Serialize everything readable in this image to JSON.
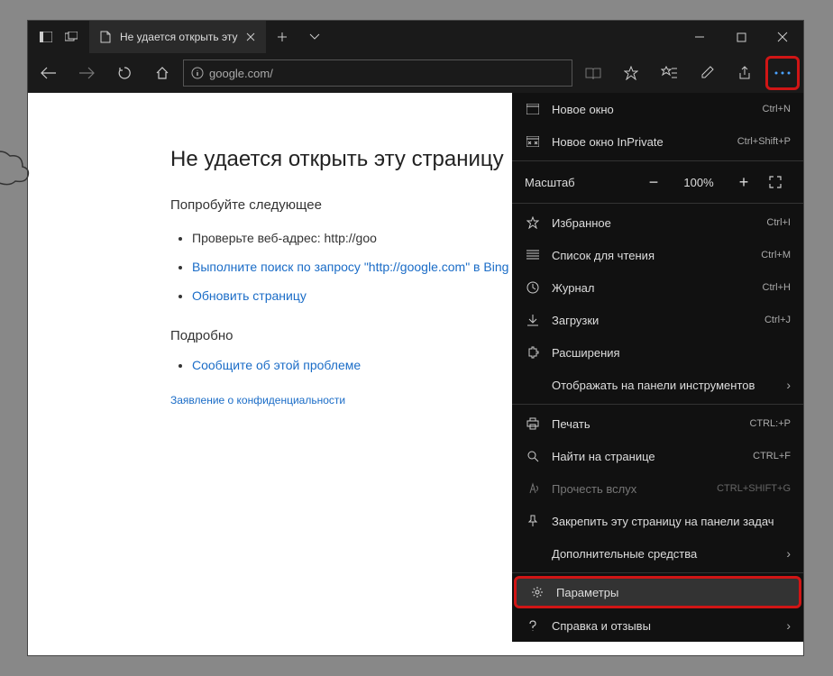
{
  "tab": {
    "title": "Не удается открыть эту"
  },
  "url": "google.com/",
  "page": {
    "title": "Не удается открыть эту страницу",
    "try_label": "Попробуйте следующее",
    "bullets": {
      "check": "Проверьте веб-адрес: http://goo",
      "search": "Выполните поиск по запросу \"http://google.com\" в Bing",
      "refresh": "Обновить страницу"
    },
    "details": "Подробно",
    "report": "Сообщите об этой проблеме",
    "privacy": "Заявление о конфиденциальности"
  },
  "menu": {
    "new_window": {
      "label": "Новое окно",
      "shortcut": "Ctrl+N"
    },
    "inprivate": {
      "label": "Новое окно InPrivate",
      "shortcut": "Ctrl+Shift+P"
    },
    "zoom": {
      "label": "Масштаб",
      "value": "100%"
    },
    "favorites": {
      "label": "Избранное",
      "shortcut": "Ctrl+I"
    },
    "reading": {
      "label": "Список для чтения",
      "shortcut": "Ctrl+M"
    },
    "history": {
      "label": "Журнал",
      "shortcut": "Ctrl+H"
    },
    "downloads": {
      "label": "Загрузки",
      "shortcut": "Ctrl+J"
    },
    "extensions": {
      "label": "Расширения"
    },
    "toolbar_show": {
      "label": "Отображать на панели инструментов"
    },
    "print": {
      "label": "Печать",
      "shortcut": "CTRL:+P"
    },
    "find": {
      "label": "Найти на странице",
      "shortcut": "CTRL+F"
    },
    "read_aloud": {
      "label": "Прочесть вслух",
      "shortcut": "CTRL+SHIFT+G"
    },
    "pin": {
      "label": "Закрепить эту страницу на панели задач"
    },
    "more_tools": {
      "label": "Дополнительные средства"
    },
    "settings": {
      "label": "Параметры"
    },
    "help": {
      "label": "Справка и отзывы"
    }
  }
}
